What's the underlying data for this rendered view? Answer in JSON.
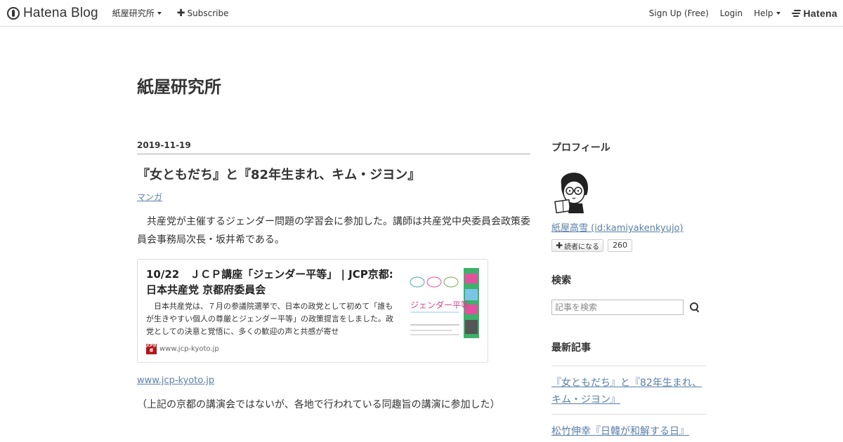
{
  "header": {
    "logo_text": "Hatena Blog",
    "blog_name": "紙屋研究所",
    "subscribe_label": "Subscribe",
    "signup_label": "Sign Up (Free)",
    "login_label": "Login",
    "help_label": "Help",
    "hatena_label": "Hatena"
  },
  "blog": {
    "title": "紙屋研究所"
  },
  "entry": {
    "date": "2019-11-19",
    "title": "『女ともだち』と『82年生まれ、キム・ジヨン』",
    "category": "マンガ",
    "paragraph1": "　共産党が主催するジェンダー問題の学習会に参加した。講師は共産党中央委員会政策委員会事務局次長・坂井希である。",
    "embed": {
      "title": "10/22　ＪＣＰ講座「ジェンダー平等」 | JCP京都: 日本共産党 京都府委員会",
      "description": "　日本共産党は、７月の参議院選挙で、日本の政党として初めて「誰もが生きやすい個人の尊厳とジェンダー平等」の政策提言をしました。政党としての決意と覚悟に、多くの歓迎の声と共感が寄せ",
      "site": "www.jcp-kyoto.jp",
      "favicon_text": "JCP京都",
      "thumb_text": "ジェンダー平等"
    },
    "link": "www.jcp-kyoto.jp",
    "paragraph2": "（上記の京都の講演会ではないが、各地で行われている同趣旨の講演に参加した）"
  },
  "sidebar": {
    "profile_title": "プロフィール",
    "profile_name": "紙屋高雪 (id:kamiyakenkyujo)",
    "reader_button": "読者になる",
    "reader_count": "260",
    "search_title": "検索",
    "search_placeholder": "記事を検索",
    "recent_title": "最新記事",
    "recent_items": [
      "『女ともだち』と『82年生まれ、キム・ジヨン』",
      "松竹伸幸『日韓が和解する日』"
    ]
  },
  "colors": {
    "link": "#5a7fa8",
    "text": "#333333",
    "favicon_red": "#b3131b"
  }
}
